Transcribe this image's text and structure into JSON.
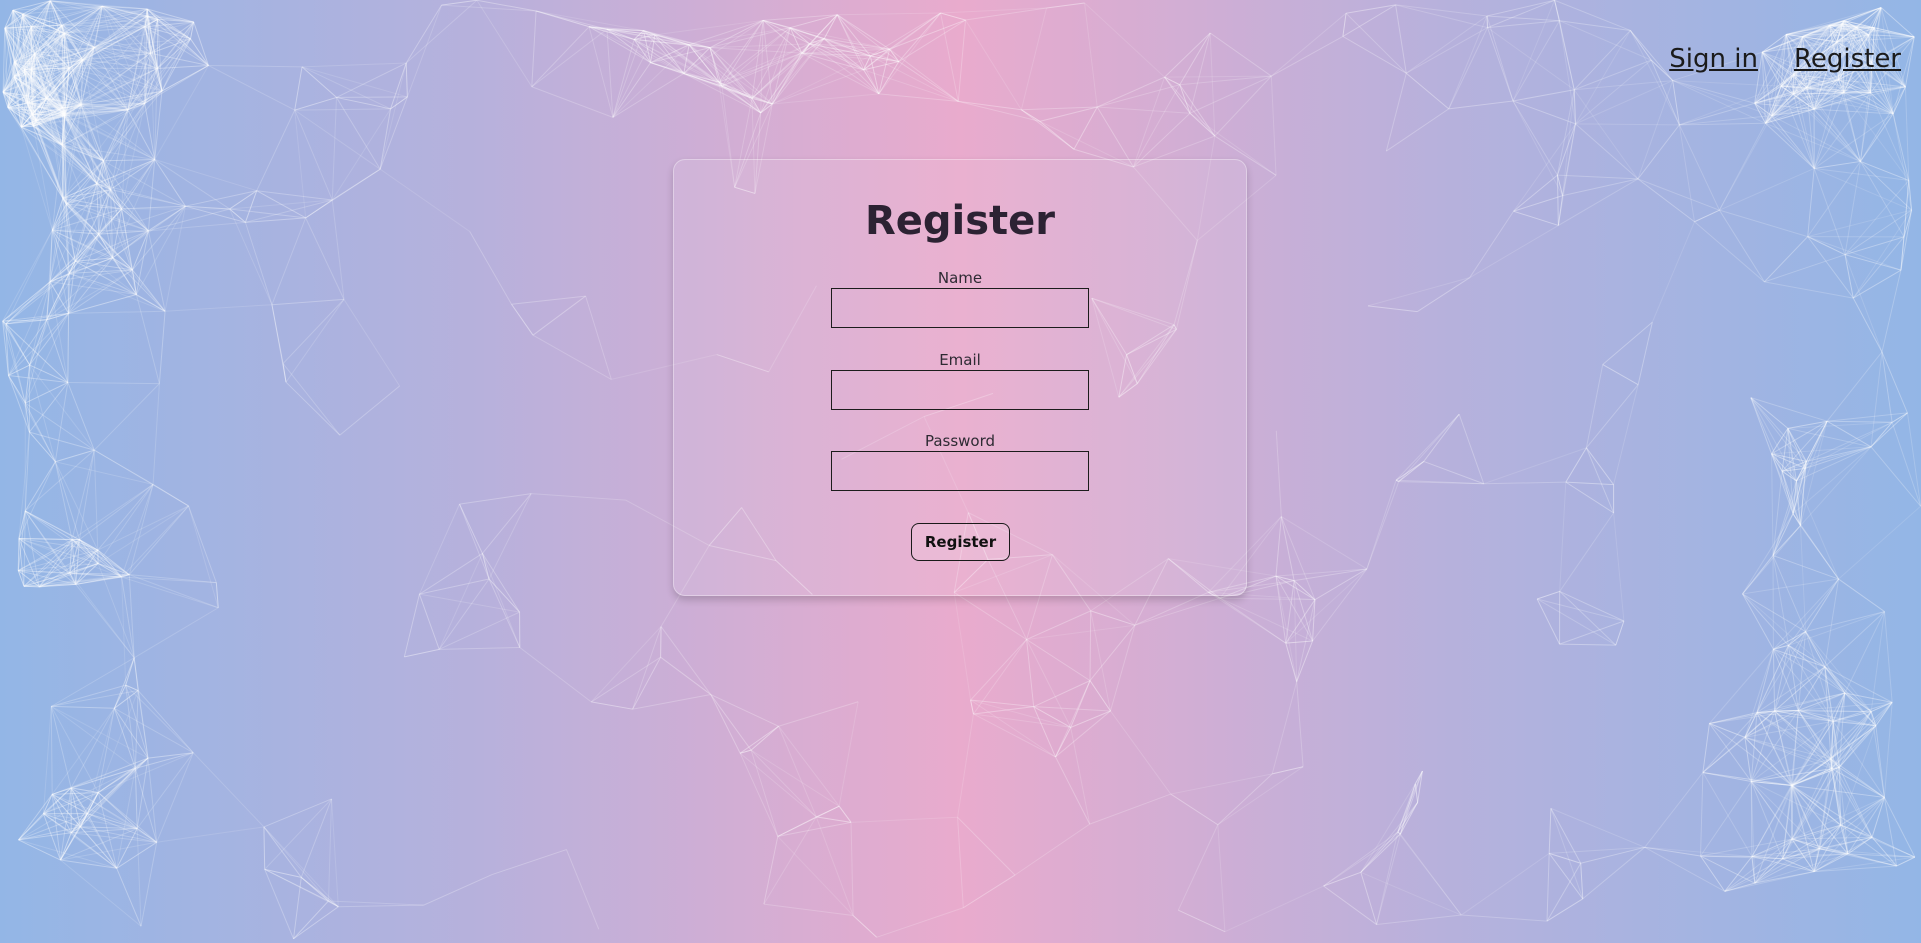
{
  "nav": {
    "sign_in": "Sign in",
    "register": "Register"
  },
  "form": {
    "title": "Register",
    "fields": [
      {
        "label": "Name",
        "value": "",
        "placeholder": ""
      },
      {
        "label": "Email",
        "value": "",
        "placeholder": ""
      },
      {
        "label": "Password",
        "value": "",
        "placeholder": ""
      }
    ],
    "submit_label": "Register"
  },
  "theme": {
    "gradient_edge": "#93b6e6",
    "gradient_mid": "#b7b1dc",
    "gradient_center": "#e9abcd",
    "network_lines": "#ffffff"
  }
}
